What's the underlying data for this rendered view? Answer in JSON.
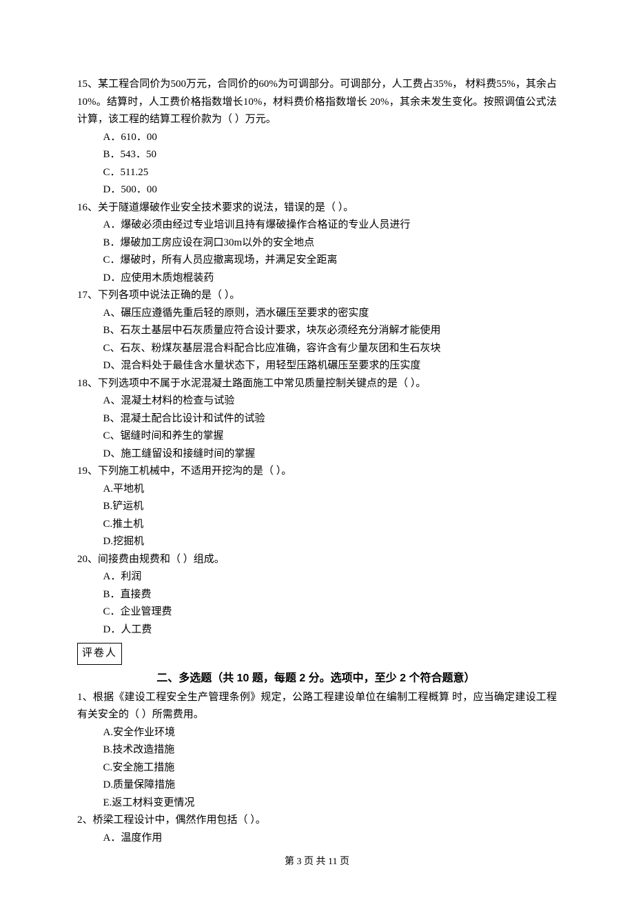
{
  "q15": {
    "stem": "15、某工程合同价为500万元，合同价的60%为可调部分。可调部分，人工费占35%，  材料费55%，其余占10%。结算时，人工费价格指数增长10%，材料费价格指数增长 20%，其余未发生变化。按照调值公式法计算，该工程的结算工程价款为（    ）万元。",
    "A": "A．610．00",
    "B": "B．543．50",
    "C": "C．511.25",
    "D": "D．500．00"
  },
  "q16": {
    "stem": "16、关于隧道爆破作业安全技术要求的说法，错误的是（    ）。",
    "A": "A．爆破必须由经过专业培训且持有爆破操作合格证的专业人员进行",
    "B": "B．爆破加工房应设在洞口30m以外的安全地点",
    "C": "C．爆破时，所有人员应撤离现场，并满足安全距离",
    "D": "D．应使用木质炮棍装药"
  },
  "q17": {
    "stem": "17、下列各项中说法正确的是（    ）。",
    "A": "A、碾压应遵循先重后轻的原则，洒水碾压至要求的密实度",
    "B": "B、石灰土基层中石灰质量应符合设计要求，块灰必须经充分消解才能使用",
    "C": "C、石灰、粉煤灰基层混合料配合比应准确，容许含有少量灰团和生石灰块",
    "D": "D、混合料处于最佳含水量状态下，用轻型压路机碾压至要求的压实度"
  },
  "q18": {
    "stem": "18、下列选项中不属于水泥混凝土路面施工中常见质量控制关键点的是（    ）。",
    "A": "A、混凝土材料的检查与试验",
    "B": "B、混凝土配合比设计和试件的试验",
    "C": "C、锯缝时间和养生的掌握",
    "D": "D、施工缝留设和接缝时间的掌握"
  },
  "q19": {
    "stem": "19、下列施工机械中，不适用开挖沟的是（    ）。",
    "A": "A.平地机",
    "B": "B.铲运机",
    "C": "C.推土机",
    "D": "D.挖掘机"
  },
  "q20": {
    "stem": "20、间接费由规费和（    ）组成。",
    "A": "A．利润",
    "B": "B．直接费",
    "C": "C．企业管理费",
    "D": "D．人工费"
  },
  "grader_box": "评卷人",
  "section2_title": "二、多选题（共 10 题，每题 2 分。选项中，至少 2 个符合题意）",
  "m1": {
    "stem": "1、根据《建设工程安全生产管理条例》规定，公路工程建设单位在编制工程概算 时，应当确定建设工程有关安全的（    ）所需费用。",
    "A": "A.安全作业环境",
    "B": "B.技术改造措施",
    "C": "C.安全施工措施",
    "D": "D.质量保障措施",
    "E": "E.返工材料变更情况"
  },
  "m2": {
    "stem": "2、桥梁工程设计中，偶然作用包括（    ）。",
    "A": "A．温度作用"
  },
  "footer": "第 3 页 共 11 页"
}
